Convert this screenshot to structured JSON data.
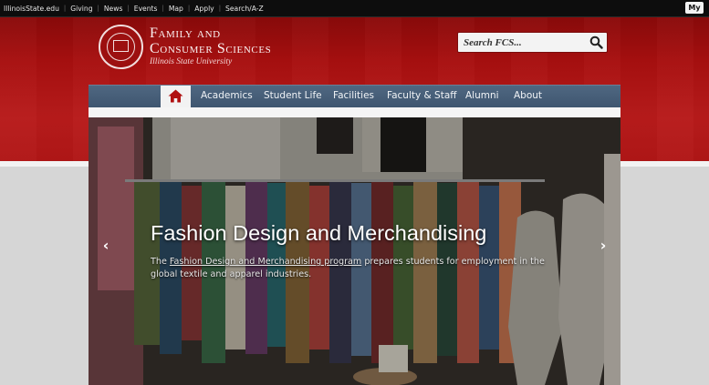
{
  "utility_nav": {
    "items": [
      "IllinoisState.edu",
      "Giving",
      "News",
      "Events",
      "Map",
      "Apply",
      "Search/A-Z"
    ],
    "my_label": "My"
  },
  "header": {
    "dept_line1": "Family and",
    "dept_line2": "Consumer Sciences",
    "university": "Illinois State University",
    "search_placeholder": "Search FCS..."
  },
  "main_nav": {
    "home_icon": "house-icon",
    "items": [
      "Academics",
      "Student Life",
      "Facilities",
      "Faculty & Staff",
      "Alumni",
      "About"
    ]
  },
  "slide": {
    "title": "Fashion Design and Merchandising",
    "caption_before": "The ",
    "caption_link": "Fashion Design and Merchandising program",
    "caption_after": " prepares students for employment in the global textile and apparel industries.",
    "prev_label": "‹",
    "next_label": "›"
  },
  "colors": {
    "brand_red": "#a70f0f",
    "nav_blue": "#4a6179",
    "home_icon_red": "#b01010"
  }
}
